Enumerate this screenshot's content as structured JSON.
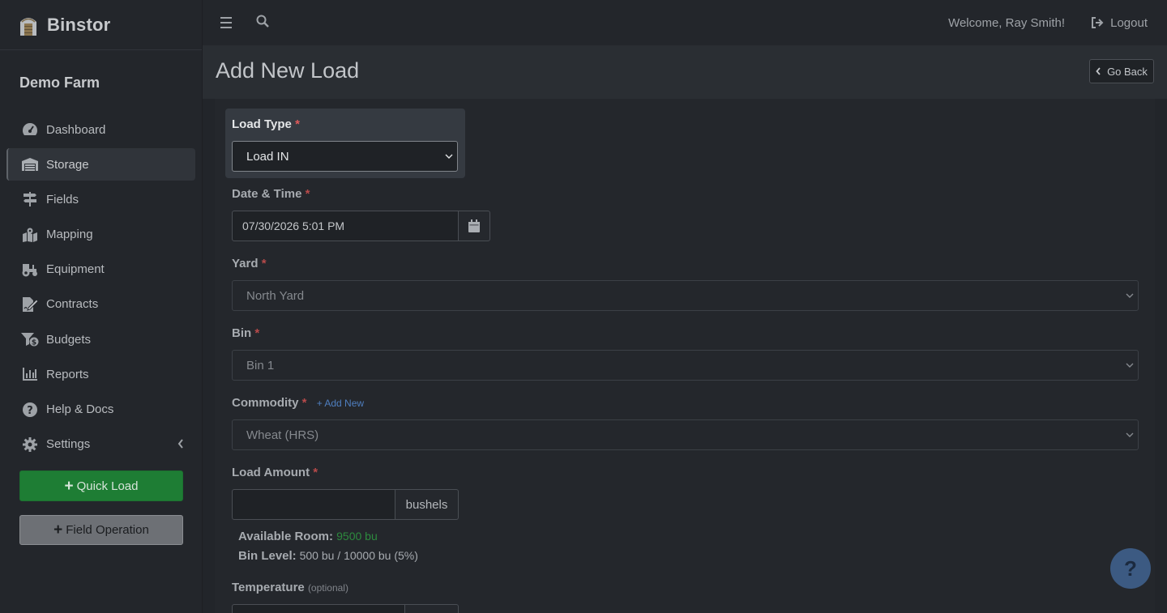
{
  "brand": {
    "name": "Binstor"
  },
  "farm": {
    "name": "Demo Farm"
  },
  "sidebar": {
    "items": [
      {
        "label": "Dashboard",
        "icon": "dashboard-icon"
      },
      {
        "label": "Storage",
        "icon": "warehouse-icon"
      },
      {
        "label": "Fields",
        "icon": "signpost-icon"
      },
      {
        "label": "Mapping",
        "icon": "map-marked-icon"
      },
      {
        "label": "Equipment",
        "icon": "tractor-icon"
      },
      {
        "label": "Contracts",
        "icon": "file-signature-icon"
      },
      {
        "label": "Budgets",
        "icon": "funnel-dollar-icon"
      },
      {
        "label": "Reports",
        "icon": "chart-bar-icon"
      },
      {
        "label": "Help & Docs",
        "icon": "question-circle-icon"
      },
      {
        "label": "Settings",
        "icon": "gear-icon"
      }
    ],
    "quick_load": "Quick Load",
    "field_operation": "Field Operation"
  },
  "topbar": {
    "welcome": "Welcome, Ray Smith!",
    "logout": "Logout"
  },
  "header": {
    "title": "Add New Load",
    "go_back": "Go Back"
  },
  "form": {
    "load_type": {
      "label": "Load Type",
      "required": "*",
      "value": "Load IN"
    },
    "datetime": {
      "label": "Date & Time",
      "required": "*",
      "value": "07/30/2026 5:01 PM"
    },
    "yard": {
      "label": "Yard",
      "required": "*",
      "value": "North Yard"
    },
    "bin": {
      "label": "Bin",
      "required": "*",
      "value": "Bin 1"
    },
    "commodity": {
      "label": "Commodity",
      "required": "*",
      "add_new": "+ Add New",
      "value": "Wheat (HRS)"
    },
    "load_amount": {
      "label": "Load Amount",
      "required": "*",
      "value": "",
      "unit": "bushels"
    },
    "available_room": {
      "label": "Available Room:",
      "value": "9500 bu"
    },
    "bin_level": {
      "label": "Bin Level:",
      "value": "500 bu / 10000 bu (5%)"
    },
    "temperature": {
      "label": "Temperature",
      "optional": "(optional)"
    }
  },
  "help_fab": {
    "label": "?"
  },
  "colors": {
    "accent_green": "#1e7d34",
    "required_red": "#b74a4a",
    "link_blue": "#4f7fc0",
    "fab_blue": "#3c5a82"
  }
}
